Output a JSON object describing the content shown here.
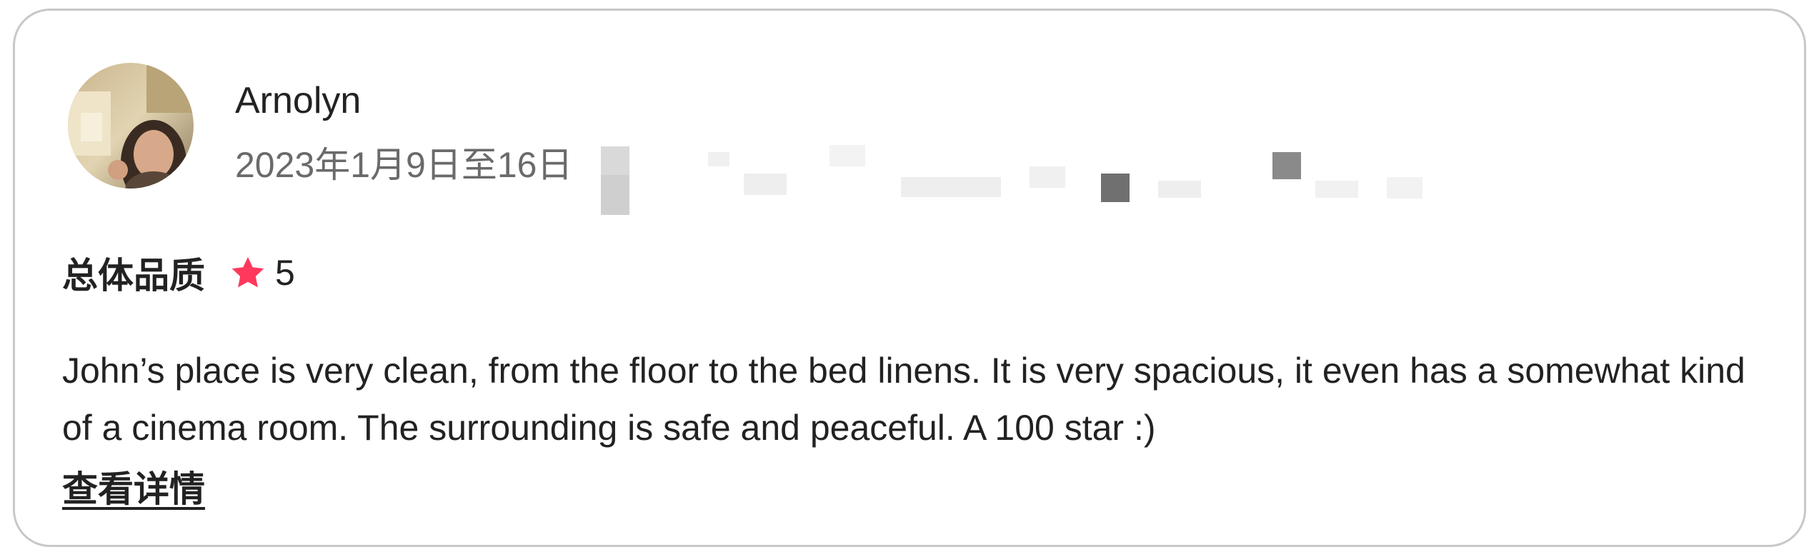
{
  "review": {
    "reviewer_name": "Arnolyn",
    "stay_dates": "2023年1月9日至16日",
    "rating_label": "总体品质",
    "rating_value": "5",
    "star_icon": "star-icon",
    "star_color": "#ff385c",
    "text": "John’s place is very clean, from the floor to the bed linens. It is very spacious, it even has a somewhat kind of a cinema room. The surrounding is safe and peaceful. A 100 star :)",
    "read_more_label": "查看详情"
  },
  "colors": {
    "border": "#c8c8c8",
    "primary_text": "#222222",
    "secondary_text": "#6a6a6a"
  }
}
